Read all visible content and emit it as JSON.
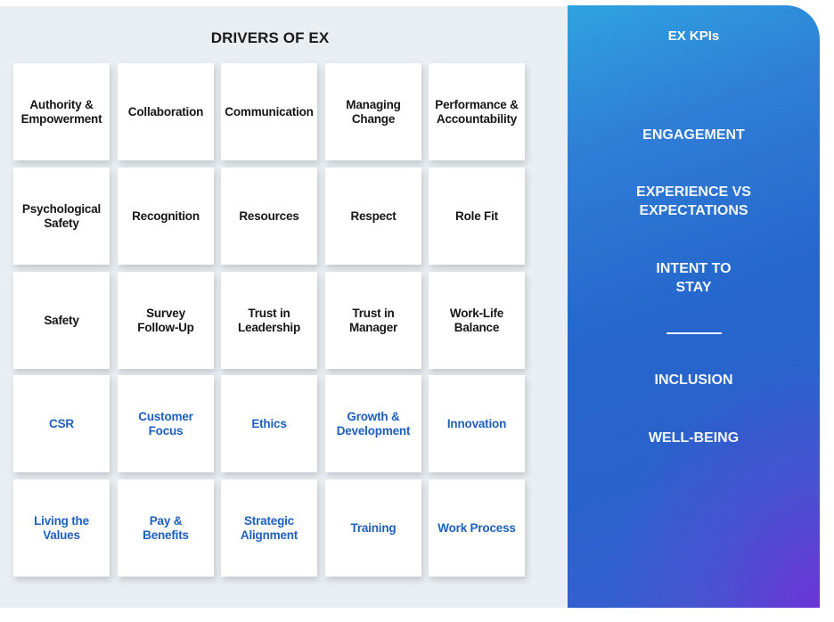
{
  "drivers": {
    "title": "DRIVERS OF EX",
    "tiles": [
      {
        "label": "Authority &\nEmpowerment",
        "group": "core"
      },
      {
        "label": "Collaboration",
        "group": "core"
      },
      {
        "label": "Communication",
        "group": "core"
      },
      {
        "label": "Managing\nChange",
        "group": "core"
      },
      {
        "label": "Performance &\nAccountability",
        "group": "core"
      },
      {
        "label": "Psychological\nSafety",
        "group": "core"
      },
      {
        "label": "Recognition",
        "group": "core"
      },
      {
        "label": "Resources",
        "group": "core"
      },
      {
        "label": "Respect",
        "group": "core"
      },
      {
        "label": "Role Fit",
        "group": "core"
      },
      {
        "label": "Safety",
        "group": "core"
      },
      {
        "label": "Survey\nFollow-Up",
        "group": "core"
      },
      {
        "label": "Trust in\nLeadership",
        "group": "core"
      },
      {
        "label": "Trust in\nManager",
        "group": "core"
      },
      {
        "label": "Work-Life\nBalance",
        "group": "core"
      },
      {
        "label": "CSR",
        "group": "accent"
      },
      {
        "label": "Customer\nFocus",
        "group": "accent"
      },
      {
        "label": "Ethics",
        "group": "accent"
      },
      {
        "label": "Growth &\nDevelopment",
        "group": "accent"
      },
      {
        "label": "Innovation",
        "group": "accent"
      },
      {
        "label": "Living the\nValues",
        "group": "accent"
      },
      {
        "label": "Pay &\nBenefits",
        "group": "accent"
      },
      {
        "label": "Strategic\nAlignment",
        "group": "accent"
      },
      {
        "label": "Training",
        "group": "accent"
      },
      {
        "label": "Work Process",
        "group": "accent"
      }
    ]
  },
  "kpis": {
    "title": "EX KPIs",
    "primary": [
      "ENGAGEMENT",
      "EXPERIENCE VS\nEXPECTATIONS",
      "INTENT TO\nSTAY"
    ],
    "secondary": [
      "INCLUSION",
      "WELL-BEING"
    ]
  },
  "colors": {
    "core_text": "#161616",
    "accent_text": "#1e5fbf",
    "panel_bg": "#e9eef2",
    "kpi_gradient_start": "#2fa3e0",
    "kpi_gradient_mid": "#2566cc",
    "kpi_gradient_end": "#5a35d0"
  }
}
